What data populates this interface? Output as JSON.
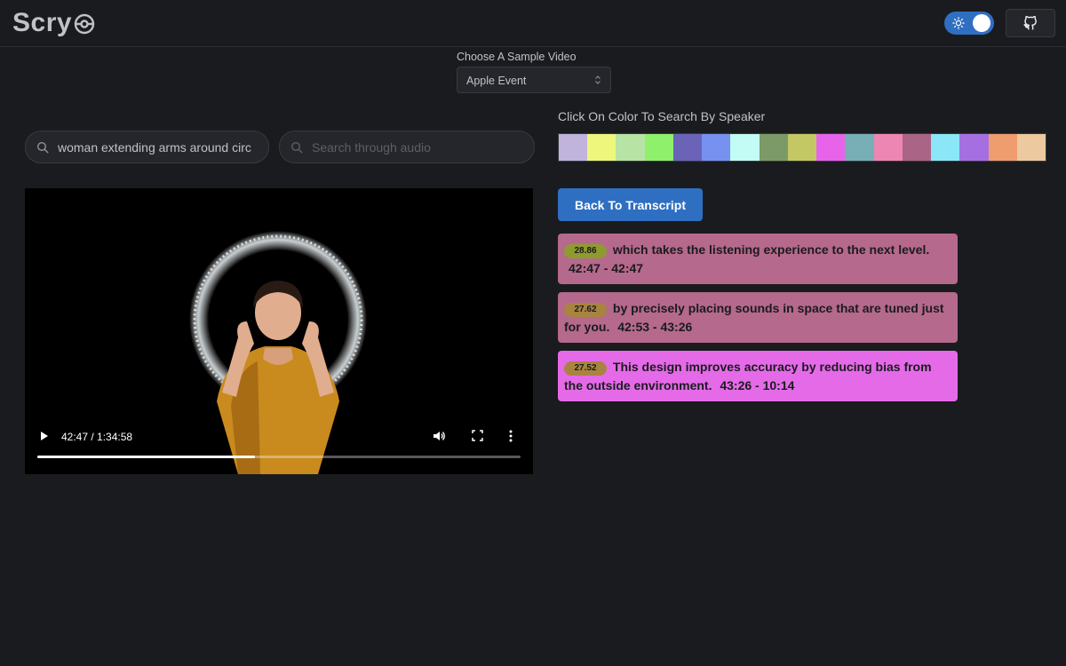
{
  "app": {
    "title": "Scry"
  },
  "header": {
    "theme_toggle": "on",
    "github_icon": "github-icon"
  },
  "sample": {
    "label": "Choose A Sample Video",
    "selected": "Apple Event"
  },
  "search": {
    "video_query": "woman extending arms around circ",
    "audio_placeholder": "Search through audio"
  },
  "speakers": {
    "label": "Click On Color To Search By Speaker",
    "colors": [
      "#c0b4dd",
      "#eef77c",
      "#b7e3a5",
      "#8ff06b",
      "#6a63b8",
      "#7791f1",
      "#c2fcf5",
      "#7c9a67",
      "#c3c864",
      "#e764ea",
      "#78aeb6",
      "#ed86b3",
      "#a96486",
      "#8be6f7",
      "#a66fe1",
      "#ef9d6e",
      "#ecc99f"
    ]
  },
  "video": {
    "time": "42:47 / 1:34:58",
    "progress": 0.45
  },
  "transcript": {
    "back_label": "Back To Transcript",
    "results": [
      {
        "score": "28.86",
        "text": "which takes the listening experience to the next level.",
        "time": "42:47 - 42:47",
        "color": "#b5698c",
        "badge": "#8e9b2e"
      },
      {
        "score": "27.62",
        "text": "by precisely placing sounds in space that are tuned just for you.",
        "time": "42:53 - 43:26",
        "color": "#b5698c",
        "badge": "#a88440"
      },
      {
        "score": "27.52",
        "text": "This design improves accuracy by reducing bias from the outside environment.",
        "time": "43:26 - 10:14",
        "color": "#e56ae8",
        "badge": "#a88440"
      }
    ]
  }
}
